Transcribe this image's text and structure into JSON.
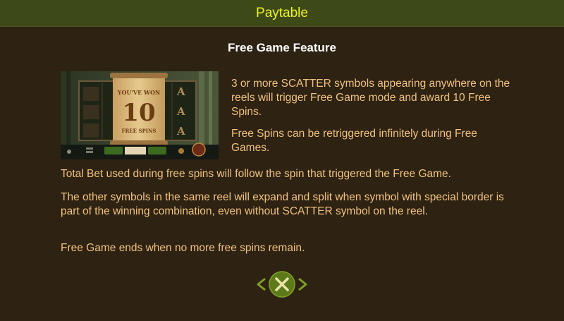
{
  "header": {
    "title": "Paytable"
  },
  "section": {
    "title": "Free Game Feature"
  },
  "thumbnail": {
    "banner_line1": "YOU'VE WON",
    "banner_number": "10",
    "banner_line2": "FREE SPINS"
  },
  "paragraphs": {
    "p1": "3 or more SCATTER symbols appearing anywhere on the reels will trigger Free Game mode and award 10 Free Spins.",
    "p2": "Free Spins can be retriggered infinitely during Free Games.",
    "p3": "Total Bet used during free spins will follow the spin that triggered the Free Game.",
    "p4": "The other symbols in the same reel will expand and split when symbol with special border is part of the winning combination, even without SCATTER symbol on the reel.",
    "p5": "Free Game ends when no more free spins remain."
  },
  "nav": {
    "prev_icon": "chevron-left-icon",
    "close_icon": "close-x-icon",
    "next_icon": "chevron-right-icon"
  },
  "colors": {
    "header_bg": "#3d4a17",
    "title": "#eef21c",
    "text": "#f0c27e",
    "bg": "#2e2213",
    "button": "#5d7a1a"
  }
}
